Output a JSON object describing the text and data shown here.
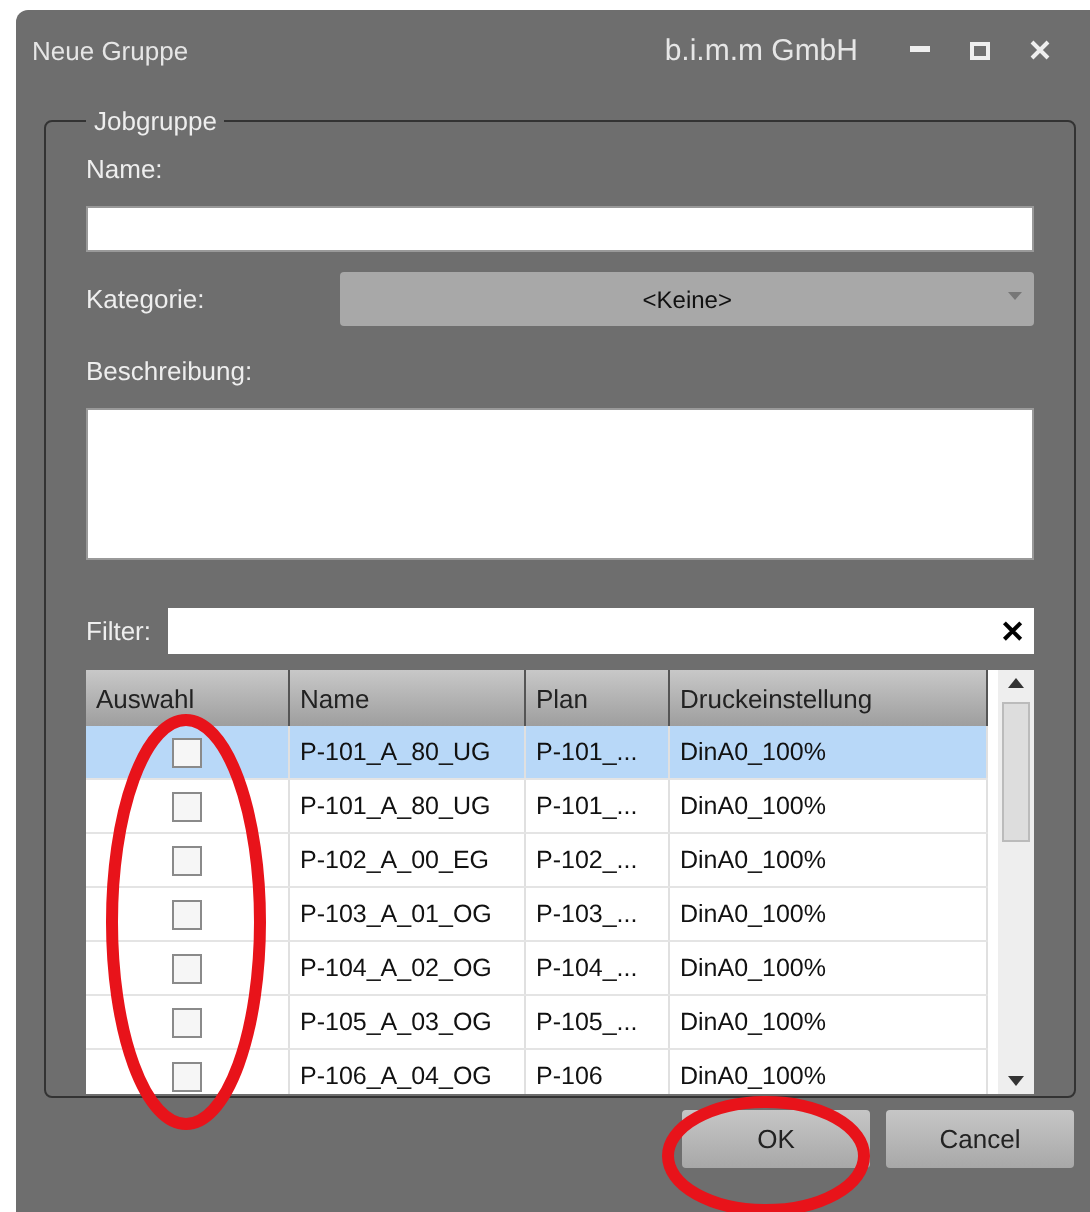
{
  "window": {
    "title": "Neue Gruppe",
    "company": "b.i.m.m GmbH"
  },
  "group": {
    "title": "Jobgruppe",
    "name": {
      "label": "Name:"
    },
    "category": {
      "label": "Kategorie:",
      "value": "<Keine>"
    },
    "description": {
      "label": "Beschreibung:"
    },
    "filter": {
      "label": "Filter:",
      "clear": "✕"
    },
    "table": {
      "columns": [
        "Auswahl",
        "Name",
        "Plan",
        "Druckeinstellung"
      ],
      "rows": [
        {
          "checked": false,
          "selected": true,
          "name": "P-101_A_80_UG",
          "plan": "P-101_...",
          "setting": "DinA0_100%"
        },
        {
          "checked": false,
          "selected": false,
          "name": "P-101_A_80_UG",
          "plan": "P-101_...",
          "setting": "DinA0_100%"
        },
        {
          "checked": false,
          "selected": false,
          "name": "P-102_A_00_EG",
          "plan": "P-102_...",
          "setting": "DinA0_100%"
        },
        {
          "checked": false,
          "selected": false,
          "name": "P-103_A_01_OG",
          "plan": "P-103_...",
          "setting": "DinA0_100%"
        },
        {
          "checked": false,
          "selected": false,
          "name": "P-104_A_02_OG",
          "plan": "P-104_...",
          "setting": "DinA0_100%"
        },
        {
          "checked": false,
          "selected": false,
          "name": "P-105_A_03_OG",
          "plan": "P-105_...",
          "setting": "DinA0_100%"
        },
        {
          "checked": false,
          "selected": false,
          "name": "P-106_A_04_OG",
          "plan": "P-106",
          "setting": "DinA0_100%"
        }
      ]
    }
  },
  "buttons": [
    "OK",
    "Cancel"
  ],
  "annotations": [
    {
      "kind": "ellipse"
    },
    {
      "kind": "ellipse"
    }
  ]
}
